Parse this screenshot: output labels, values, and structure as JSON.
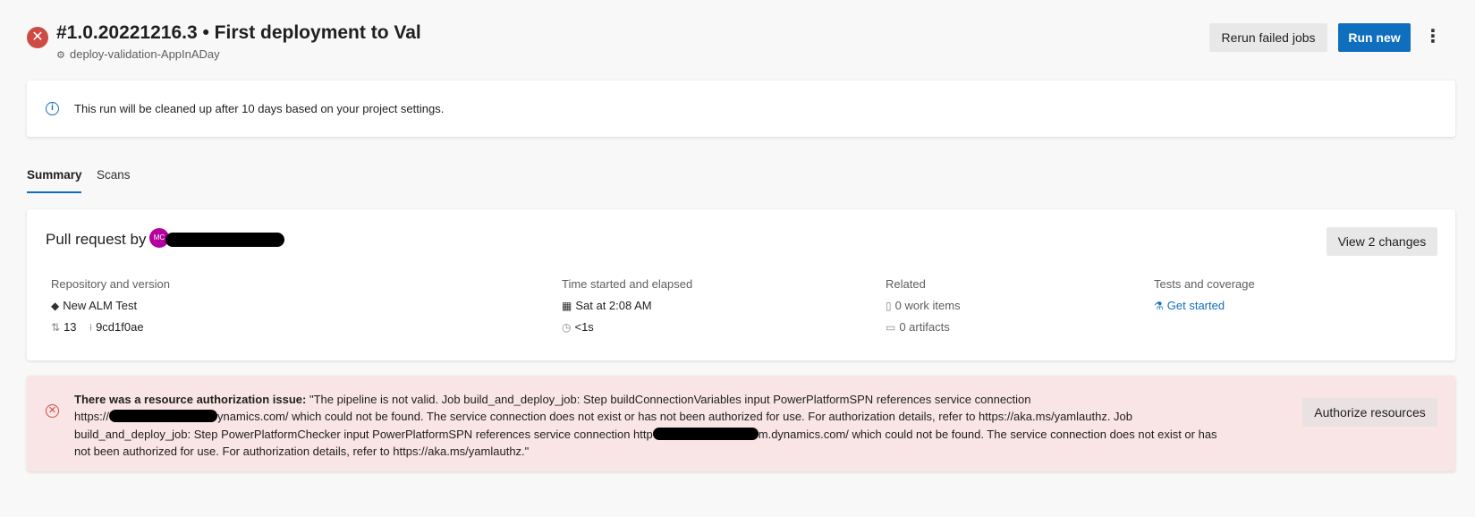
{
  "header": {
    "status_icon": "error-x-icon",
    "run_title": "#1.0.20221216.3 • First deployment to Val",
    "pipeline_icon": "pipeline-icon",
    "pipeline_name": "deploy-validation-AppInADay",
    "rerun_label": "Rerun failed jobs",
    "run_new_label": "Run new",
    "more_icon": "more-vertical-icon"
  },
  "retention_banner": {
    "icon": "info-icon",
    "text": "This run will be cleaned up after 10 days based on your project settings."
  },
  "tabs": [
    {
      "label": "Summary",
      "selected": true
    },
    {
      "label": "Scans",
      "selected": false
    }
  ],
  "summary": {
    "pr_title": "Pull request by",
    "avatar_initials": "MC",
    "view_changes_label": "View 2 changes",
    "repository": {
      "heading": "Repository and version",
      "repo_name": "New ALM Test",
      "pr_number": "13",
      "commit": "9cd1f0ae"
    },
    "time": {
      "heading": "Time started and elapsed",
      "started": "Sat at 2:08 AM",
      "elapsed": "<1s"
    },
    "related": {
      "heading": "Related",
      "work_items": "0 work items",
      "artifacts": "0 artifacts"
    },
    "tests": {
      "heading": "Tests and coverage",
      "link": "Get started"
    }
  },
  "error_banner": {
    "icon": "error-circle-icon",
    "title": "There was a resource authorization issue:",
    "line1": "\"The pipeline is not valid. Job build_and_deploy_job: Step buildConnectionVariables input PowerPlatformSPN references service connection",
    "line2_prefix": "https://",
    "line2_suffix": "ynamics.com/ which could not be found. The service connection does not exist or has not been authorized for use. For authorization details, refer to https://aka.ms/yamlauthz. Job",
    "line3_prefix": "build_and_deploy_job: Step PowerPlatformChecker input PowerPlatformSPN references service connection http",
    "line3_suffix": "m.dynamics.com/ which could not be found. The service connection does not exist or has",
    "line4": "not been authorized for use. For authorization details, refer to https://aka.ms/yamlauthz.\"",
    "button_label": "Authorize resources"
  }
}
